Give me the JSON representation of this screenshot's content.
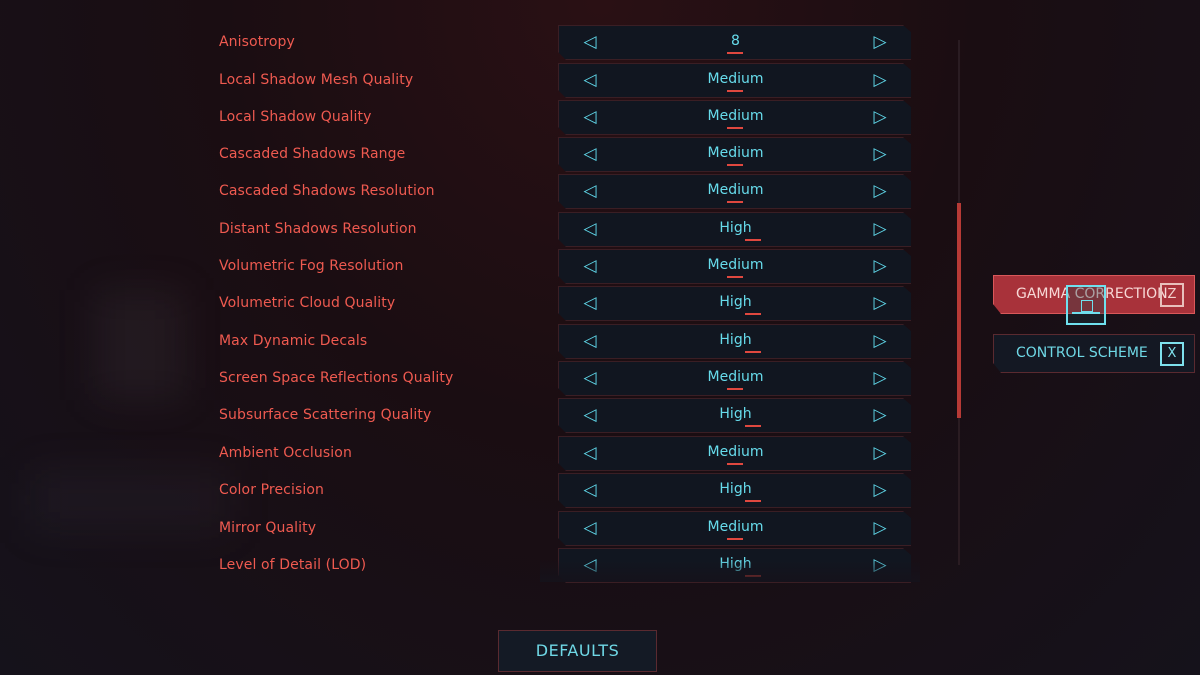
{
  "settings": {
    "rows": [
      {
        "label": "Anisotropy",
        "value": "8"
      },
      {
        "label": "Local Shadow Mesh Quality",
        "value": "Medium"
      },
      {
        "label": "Local Shadow Quality",
        "value": "Medium"
      },
      {
        "label": "Cascaded Shadows Range",
        "value": "Medium"
      },
      {
        "label": "Cascaded Shadows Resolution",
        "value": "Medium"
      },
      {
        "label": "Distant Shadows Resolution",
        "value": "High"
      },
      {
        "label": "Volumetric Fog Resolution",
        "value": "Medium"
      },
      {
        "label": "Volumetric Cloud Quality",
        "value": "High"
      },
      {
        "label": "Max Dynamic Decals",
        "value": "High"
      },
      {
        "label": "Screen Space Reflections Quality",
        "value": "Medium"
      },
      {
        "label": "Subsurface Scattering Quality",
        "value": "High"
      },
      {
        "label": "Ambient Occlusion",
        "value": "Medium"
      },
      {
        "label": "Color Precision",
        "value": "High"
      },
      {
        "label": "Mirror Quality",
        "value": "Medium"
      },
      {
        "label": "Level of Detail (LOD)",
        "value": "High"
      }
    ],
    "arrow_left": "◁",
    "arrow_right": "▷"
  },
  "side_buttons": {
    "gamma": {
      "label": "GAMMA CORRECTION",
      "key": "Z"
    },
    "control": {
      "label": "CONTROL SCHEME",
      "key": "X"
    }
  },
  "footer": {
    "defaults_label": "DEFAULTS"
  },
  "colors": {
    "label_red": "#ef5a50",
    "value_cyan": "#67dcec",
    "accent_red": "#a8323a"
  }
}
